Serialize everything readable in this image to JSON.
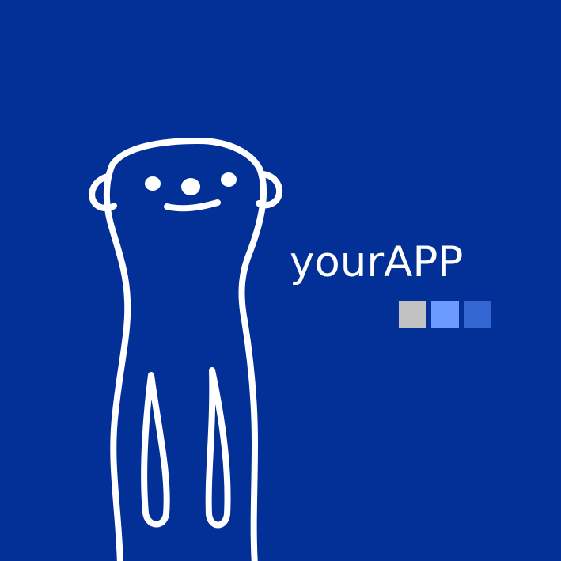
{
  "app": {
    "title": "yourAPP"
  },
  "theme": {
    "background": "#023096",
    "foreground": "#ffffff"
  },
  "swatches": [
    {
      "name": "gray",
      "color": "#c2c2c2"
    },
    {
      "name": "light-blue",
      "color": "#6b9bff"
    },
    {
      "name": "medium-blue",
      "color": "#3366d1"
    }
  ],
  "mascot": {
    "icon": "meerkat-outline-icon"
  }
}
